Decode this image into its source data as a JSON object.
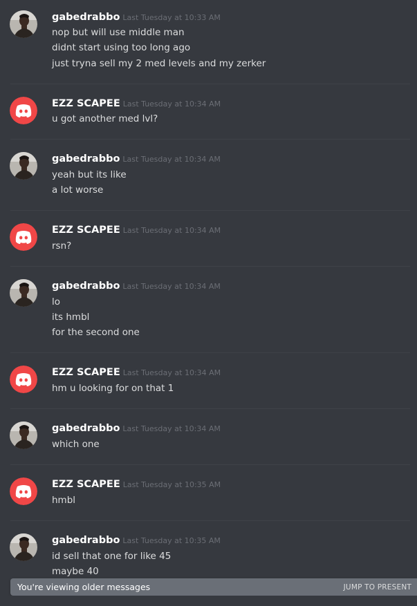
{
  "colors": {
    "background": "#36393f",
    "discord_red": "#f04747",
    "username": "#ffffff",
    "text": "#dcddde",
    "timestamp": "#6b6e75",
    "banner": "#6a6f77"
  },
  "messages": [
    {
      "author": "gabedrabbo",
      "avatar_icon": "photo-avatar-icon",
      "timestamp": "Last Tuesday at 10:33 AM",
      "lines": [
        "nop but will use middle man",
        "didnt start using too long ago",
        "just tryna sell my 2 med levels and my zerker"
      ]
    },
    {
      "author": "EZZ SCAPEE",
      "avatar_icon": "discord-logo-icon",
      "timestamp": "Last Tuesday at 10:34 AM",
      "lines": [
        "u got another med lvl?"
      ]
    },
    {
      "author": "gabedrabbo",
      "avatar_icon": "photo-avatar-icon",
      "timestamp": "Last Tuesday at 10:34 AM",
      "lines": [
        "yeah but its like",
        "a lot worse"
      ]
    },
    {
      "author": "EZZ SCAPEE",
      "avatar_icon": "discord-logo-icon",
      "timestamp": "Last Tuesday at 10:34 AM",
      "lines": [
        "rsn?"
      ]
    },
    {
      "author": "gabedrabbo",
      "avatar_icon": "photo-avatar-icon",
      "timestamp": "Last Tuesday at 10:34 AM",
      "lines": [
        "lo",
        "its hmbl",
        "for the second one"
      ]
    },
    {
      "author": "EZZ SCAPEE",
      "avatar_icon": "discord-logo-icon",
      "timestamp": "Last Tuesday at 10:34 AM",
      "lines": [
        "hm u looking for on that 1"
      ]
    },
    {
      "author": "gabedrabbo",
      "avatar_icon": "photo-avatar-icon",
      "timestamp": "Last Tuesday at 10:34 AM",
      "lines": [
        "which one"
      ]
    },
    {
      "author": "EZZ SCAPEE",
      "avatar_icon": "discord-logo-icon",
      "timestamp": "Last Tuesday at 10:35 AM",
      "lines": [
        "hmbl"
      ]
    },
    {
      "author": "gabedrabbo",
      "avatar_icon": "photo-avatar-icon",
      "timestamp": "Last Tuesday at 10:35 AM",
      "lines": [
        "id sell that one for like 45",
        "maybe 40"
      ]
    }
  ],
  "banner": {
    "text": "You're viewing older messages",
    "jump_label": "JUMP TO PRESENT"
  }
}
